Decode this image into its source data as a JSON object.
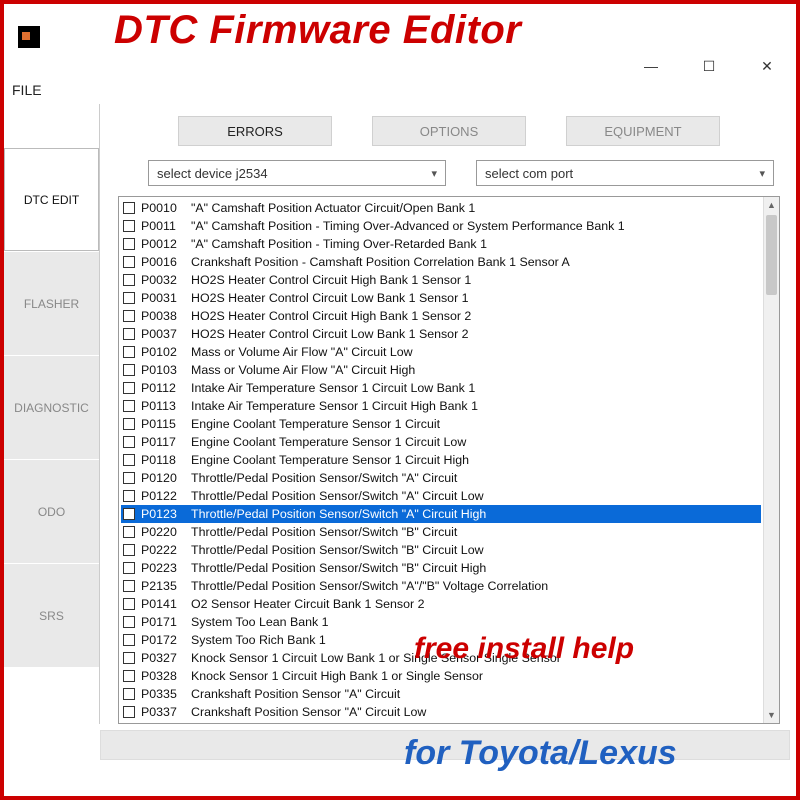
{
  "overlay": {
    "title": "DTC Firmware Editor",
    "help": "free install help",
    "brand": "for Toyota/Lexus"
  },
  "menu": {
    "file": "FILE"
  },
  "window_controls": {
    "min": "—",
    "max": "☐",
    "close": "✕"
  },
  "sidebar": {
    "items": [
      {
        "label": "DTC EDIT",
        "active": true
      },
      {
        "label": "FLASHER",
        "active": false
      },
      {
        "label": "DIAGNOSTIC",
        "active": false
      },
      {
        "label": "ODO",
        "active": false
      },
      {
        "label": "SRS",
        "active": false
      }
    ]
  },
  "tabs": {
    "items": [
      {
        "label": "ERRORS",
        "active": true
      },
      {
        "label": "OPTIONS",
        "active": false
      },
      {
        "label": "EQUIPMENT",
        "active": false
      }
    ]
  },
  "combos": {
    "device": "select device j2534",
    "port": "select com port"
  },
  "selected_index": 17,
  "codes": [
    {
      "code": "P0010",
      "desc": "\"A\" Camshaft Position Actuator Circuit/Open Bank 1"
    },
    {
      "code": "P0011",
      "desc": "\"A\" Camshaft Position - Timing Over-Advanced or System Performance Bank 1"
    },
    {
      "code": "P0012",
      "desc": "\"A\" Camshaft Position - Timing Over-Retarded Bank 1"
    },
    {
      "code": "P0016",
      "desc": "Crankshaft Position - Camshaft Position Correlation Bank 1 Sensor A"
    },
    {
      "code": "P0032",
      "desc": "HO2S Heater Control Circuit High Bank 1 Sensor 1"
    },
    {
      "code": "P0031",
      "desc": "HO2S Heater Control Circuit Low Bank 1 Sensor 1"
    },
    {
      "code": "P0038",
      "desc": "HO2S Heater Control Circuit High Bank 1 Sensor 2"
    },
    {
      "code": "P0037",
      "desc": "HO2S Heater Control Circuit Low Bank 1 Sensor 2"
    },
    {
      "code": "P0102",
      "desc": "Mass or Volume Air Flow \"A\" Circuit Low"
    },
    {
      "code": "P0103",
      "desc": "Mass or Volume Air Flow \"A\" Circuit High"
    },
    {
      "code": "P0112",
      "desc": "Intake Air Temperature Sensor 1 Circuit Low Bank 1"
    },
    {
      "code": "P0113",
      "desc": "Intake Air Temperature Sensor 1 Circuit High Bank 1"
    },
    {
      "code": "P0115",
      "desc": "Engine Coolant Temperature Sensor 1 Circuit"
    },
    {
      "code": "P0117",
      "desc": "Engine Coolant Temperature Sensor 1 Circuit Low"
    },
    {
      "code": "P0118",
      "desc": "Engine Coolant Temperature Sensor 1 Circuit High"
    },
    {
      "code": "P0120",
      "desc": "Throttle/Pedal Position Sensor/Switch \"A\" Circuit"
    },
    {
      "code": "P0122",
      "desc": "Throttle/Pedal Position Sensor/Switch \"A\" Circuit Low"
    },
    {
      "code": "P0123",
      "desc": "Throttle/Pedal Position Sensor/Switch \"A\" Circuit High"
    },
    {
      "code": "P0220",
      "desc": "Throttle/Pedal Position Sensor/Switch \"B\" Circuit"
    },
    {
      "code": "P0222",
      "desc": "Throttle/Pedal Position Sensor/Switch \"B\" Circuit Low"
    },
    {
      "code": "P0223",
      "desc": "Throttle/Pedal Position Sensor/Switch \"B\" Circuit High"
    },
    {
      "code": "P2135",
      "desc": "Throttle/Pedal Position Sensor/Switch \"A\"/\"B\" Voltage Correlation"
    },
    {
      "code": "P0141",
      "desc": "O2 Sensor Heater Circuit Bank 1 Sensor 2"
    },
    {
      "code": "P0171",
      "desc": "System Too Lean Bank 1"
    },
    {
      "code": "P0172",
      "desc": "System Too Rich Bank 1"
    },
    {
      "code": "P0327",
      "desc": "Knock Sensor 1 Circuit Low Bank 1 or Single Sensor Single Sensor"
    },
    {
      "code": "P0328",
      "desc": "Knock Sensor 1 Circuit High Bank 1 or Single Sensor"
    },
    {
      "code": "P0335",
      "desc": "Crankshaft Position Sensor \"A\" Circuit"
    },
    {
      "code": "P0337",
      "desc": "Crankshaft Position Sensor \"A\" Circuit Low"
    }
  ]
}
